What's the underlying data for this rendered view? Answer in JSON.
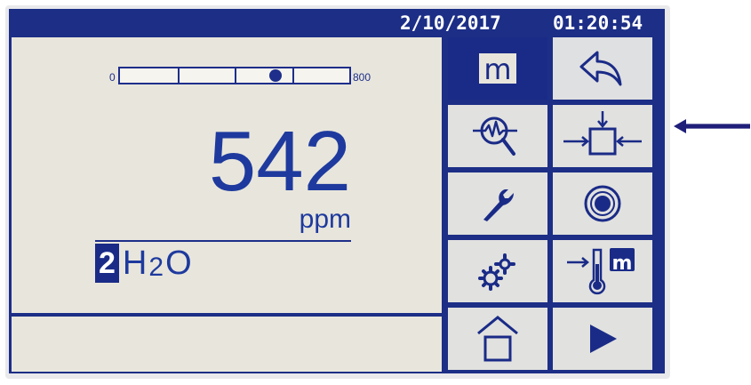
{
  "header": {
    "date": "2/10/2017",
    "time": "01:20:54"
  },
  "gauge": {
    "min_label": "0",
    "max_label": "800",
    "value_fraction": 0.68
  },
  "measurement": {
    "value": "542",
    "unit": "ppm",
    "channel_number": "2",
    "gas": {
      "h": "H",
      "sub": "2",
      "o": "O"
    }
  },
  "menu": {
    "mode_button_label": "m",
    "buttons": [
      "mode-m-button",
      "back-button",
      "diagnostics-search-button",
      "zero-calibration-button",
      "service-wrench-button",
      "target-button",
      "settings-gears-button",
      "temperature-m-button",
      "home-button",
      "next-play-button"
    ],
    "temperature_m_label": "m"
  },
  "colors": {
    "screen_frame": "#1c2e86",
    "panel": "#e8e6dc",
    "button": "#e1e1df",
    "accent": "#1a2b87",
    "text": "#1e3a9e"
  },
  "icons": {
    "back": "back-arrow-icon",
    "search": "magnifier-pulse-icon",
    "calibration": "arrows-into-box-icon",
    "wrench": "wrench-icon",
    "target": "target-icon",
    "gears": "gears-icon",
    "thermometer": "thermometer-icon",
    "home": "home-icon",
    "play": "play-icon",
    "pointer": "pointer-arrow-icon"
  }
}
